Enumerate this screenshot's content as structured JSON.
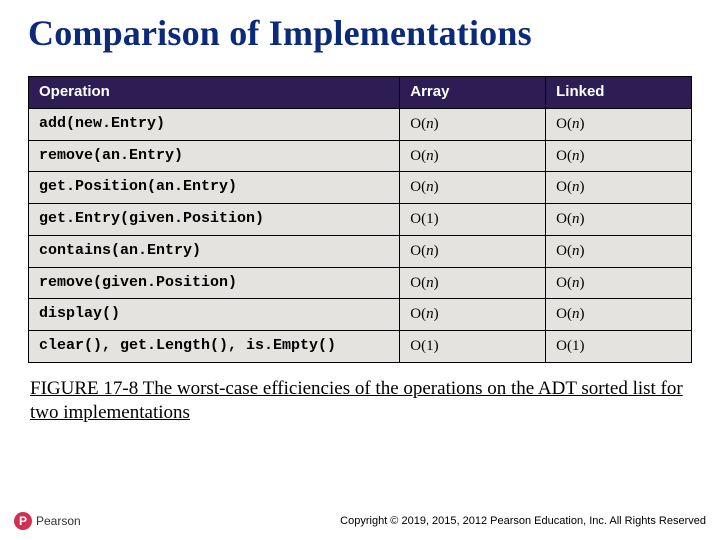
{
  "title": "Comparison of Implementations",
  "table": {
    "headers": [
      "Operation",
      "Array",
      "Linked"
    ],
    "rows": [
      {
        "op": "add(new.Entry)",
        "array": "O(n)",
        "linked": "O(n)"
      },
      {
        "op": "remove(an.Entry)",
        "array": "O(n)",
        "linked": "O(n)"
      },
      {
        "op": "get.Position(an.Entry)",
        "array": "O(n)",
        "linked": "O(n)"
      },
      {
        "op": "get.Entry(given.Position)",
        "array": "O(1)",
        "linked": "O(n)"
      },
      {
        "op": "contains(an.Entry)",
        "array": "O(n)",
        "linked": "O(n)"
      },
      {
        "op": "remove(given.Position)",
        "array": "O(n)",
        "linked": "O(n)"
      },
      {
        "op": "display()",
        "array": "O(n)",
        "linked": "O(n)"
      },
      {
        "op": "clear(), get.Length(), is.Empty()",
        "array": "O(1)",
        "linked": "O(1)"
      }
    ]
  },
  "caption": "FIGURE 17-8 The worst-case efficiencies of the operations on the ADT sorted list for two implementations",
  "logo": {
    "mark": "P",
    "text": "Pearson"
  },
  "copyright": "Copyright © 2019, 2015, 2012 Pearson Education, Inc. All Rights Reserved"
}
